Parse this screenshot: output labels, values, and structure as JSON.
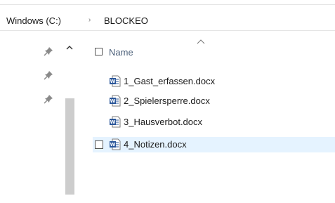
{
  "breadcrumb": {
    "root": "Windows (C:)",
    "separator": "›",
    "current": "BLOCKEO"
  },
  "nav_pane": {
    "pins": [
      "pin-icon",
      "pin-icon",
      "pin-icon"
    ],
    "scroll_up_glyph": "^"
  },
  "file_list": {
    "header": {
      "name_label": "Name",
      "sort": "ascending"
    },
    "items": [
      {
        "name": "1_Gast_erfassen.docx",
        "icon": "word-document-icon"
      },
      {
        "name": "2_Spielersperre.docx",
        "icon": "word-document-icon"
      },
      {
        "name": "3_Hausverbot.docx",
        "icon": "word-document-icon"
      },
      {
        "name": "4_Notizen.docx",
        "icon": "word-document-icon",
        "hovered": true
      }
    ]
  },
  "colors": {
    "word_blue": "#2b579a",
    "hover_background": "#e5f3ff",
    "header_text": "#4c607a"
  }
}
